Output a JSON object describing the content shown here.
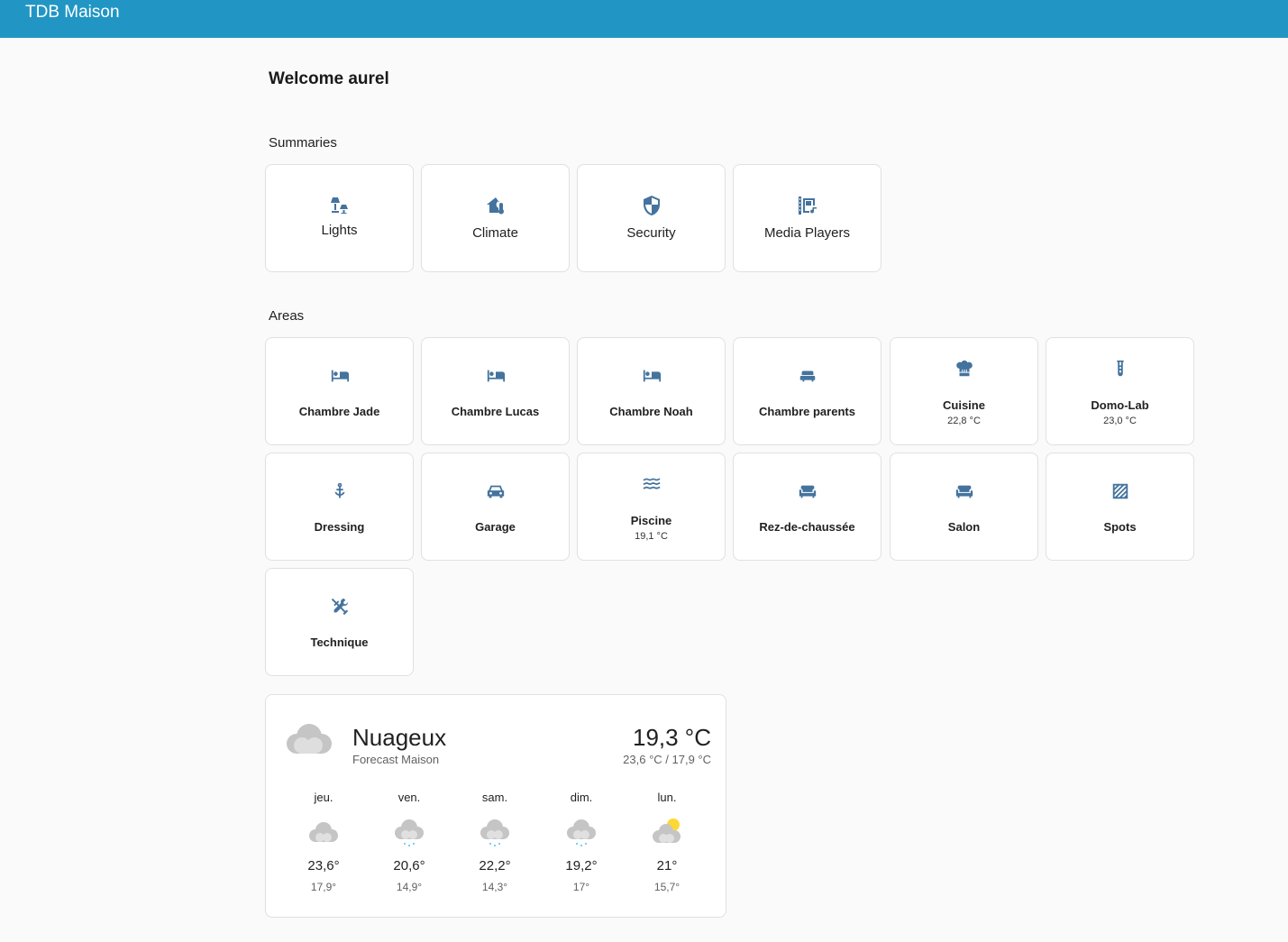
{
  "app": {
    "title": "TDB Maison"
  },
  "welcome": "Welcome aurel",
  "summaries": {
    "label": "Summaries",
    "items": [
      {
        "label": "Lights",
        "icon": "lamps-icon"
      },
      {
        "label": "Climate",
        "icon": "home-thermometer-icon"
      },
      {
        "label": "Security",
        "icon": "shield-icon"
      },
      {
        "label": "Media Players",
        "icon": "multimedia-icon"
      }
    ]
  },
  "areas": {
    "label": "Areas",
    "items": [
      {
        "label": "Chambre Jade",
        "sub": "",
        "icon": "bed-icon"
      },
      {
        "label": "Chambre Lucas",
        "sub": "",
        "icon": "bed-icon"
      },
      {
        "label": "Chambre Noah",
        "sub": "",
        "icon": "bed-icon"
      },
      {
        "label": "Chambre parents",
        "sub": "",
        "icon": "bed-small-icon"
      },
      {
        "label": "Cuisine",
        "sub": "22,8 °C",
        "icon": "chef-hat-icon"
      },
      {
        "label": "Domo-Lab",
        "sub": "23,0 °C",
        "icon": "test-tube-icon"
      },
      {
        "label": "Dressing",
        "sub": "",
        "icon": "hanger-icon"
      },
      {
        "label": "Garage",
        "sub": "",
        "icon": "car-icon"
      },
      {
        "label": "Piscine",
        "sub": "19,1 °C",
        "icon": "waves-icon"
      },
      {
        "label": "Rez-de-chaussée",
        "sub": "",
        "icon": "sofa-icon"
      },
      {
        "label": "Salon",
        "sub": "",
        "icon": "sofa-icon"
      },
      {
        "label": "Spots",
        "sub": "",
        "icon": "texture-box-icon"
      },
      {
        "label": "Technique",
        "sub": "",
        "icon": "tools-icon"
      }
    ]
  },
  "weather": {
    "condition": "Nuageux",
    "name": "Forecast Maison",
    "temperature": "19,3 °C",
    "range": "23,6 °C / 17,9 °C",
    "forecast": [
      {
        "day": "jeu.",
        "high": "23,6°",
        "low": "17,9°",
        "icon": "cloudy-icon"
      },
      {
        "day": "ven.",
        "high": "20,6°",
        "low": "14,9°",
        "icon": "rainy-icon"
      },
      {
        "day": "sam.",
        "high": "22,2°",
        "low": "14,3°",
        "icon": "rainy-icon"
      },
      {
        "day": "dim.",
        "high": "19,2°",
        "low": "17°",
        "icon": "rainy-icon"
      },
      {
        "day": "lun.",
        "high": "21°",
        "low": "15,7°",
        "icon": "partly-cloudy-icon"
      }
    ]
  },
  "colors": {
    "header": "#2196c4",
    "icon": "#44739e",
    "sun": "#fdd835",
    "rain": "#4fc3f7",
    "cloud": "#c5c5c5"
  }
}
